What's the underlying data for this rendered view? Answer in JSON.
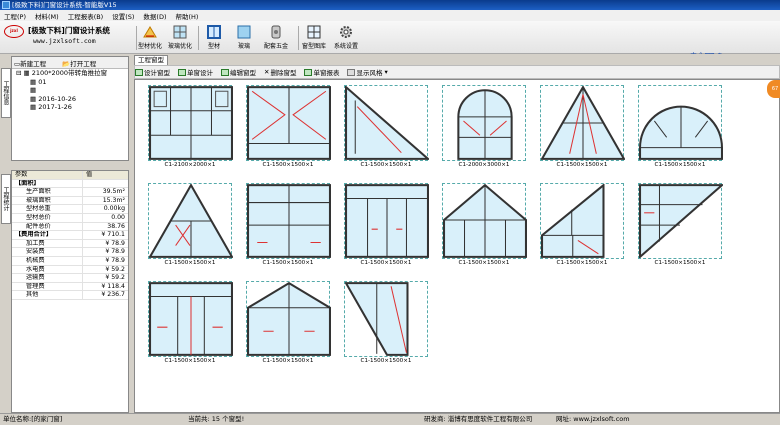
{
  "window": {
    "title": "[极致下料]门窗设计系统-智能版V15"
  },
  "menu": [
    "工程(P)",
    "材料(M)",
    "工程报表(B)",
    "设置(S)",
    "数据(D)",
    "帮助(H)"
  ],
  "toolbar": {
    "brand": "[极致下料]门窗设计系统",
    "site": "www.jzxlsoft.com",
    "logo": "jzxl",
    "buttons": [
      "型材优化",
      "玻璃优化",
      "型材",
      "玻璃",
      "配套五金",
      "窗型图库",
      "系统设置"
    ],
    "tray": [
      "中",
      "°",
      "⌨",
      "⚙",
      "≡"
    ]
  },
  "left_tabs": [
    "工程信息",
    "工程统计"
  ],
  "project": {
    "new_label": "新建工程",
    "open_label": "打开工程",
    "tree": [
      "2100*2000带转角推拉窗",
      "01",
      "",
      "2016-10-26",
      "2017-1-26"
    ]
  },
  "props": {
    "header": {
      "k": "参数",
      "v": "值"
    },
    "rows": [
      {
        "k": "【面积】",
        "v": ""
      },
      {
        "k": "生产面积",
        "v": "39.5m²"
      },
      {
        "k": "玻璃面积",
        "v": "15.3m²"
      },
      {
        "k": "型材总重",
        "v": "0.00kg"
      },
      {
        "k": "型材总价",
        "v": "0.00"
      },
      {
        "k": "配件总价",
        "v": "38.76"
      },
      {
        "k": "【费用合计】",
        "v": "¥ 710.1"
      },
      {
        "k": "加工费",
        "v": "¥ 78.9"
      },
      {
        "k": "安装费",
        "v": "¥ 78.9"
      },
      {
        "k": "机械费",
        "v": "¥ 78.9"
      },
      {
        "k": "水电费",
        "v": "¥ 59.2"
      },
      {
        "k": "运输费",
        "v": "¥ 59.2"
      },
      {
        "k": "管理费",
        "v": "¥ 118.4"
      },
      {
        "k": "其他",
        "v": "¥ 236.7"
      }
    ]
  },
  "main": {
    "tab": "工程窗型",
    "tools": [
      "设计窗型",
      "单窗设计",
      "编辑窗型",
      "删除窗型",
      "单窗报表",
      "显示风格"
    ],
    "windows": [
      "C1-2100×2000×1",
      "C1-1500×1500×1",
      "C1-1500×1500×1",
      "C1-2000×3000×1",
      "C1-1500×1500×1",
      "C1-1500×1500×1",
      "C1-1500×1500×1",
      "C1-1500×1500×1",
      "C1-1500×1500×1",
      "C1-1500×1500×1",
      "C1-1500×1500×1",
      "C1-1500×1500×1",
      "C1-1500×1500×1",
      "C1-1500×1500×1",
      "C1-1500×1500×1"
    ],
    "badge": "67"
  },
  "status": {
    "unit": "单位名称:[的家门窗]",
    "count": "当前共: 15 个窗型!",
    "dev": "研发商: 淄博有思度软件工程有限公司",
    "url": "网址: www.jzxlsoft.com"
  }
}
